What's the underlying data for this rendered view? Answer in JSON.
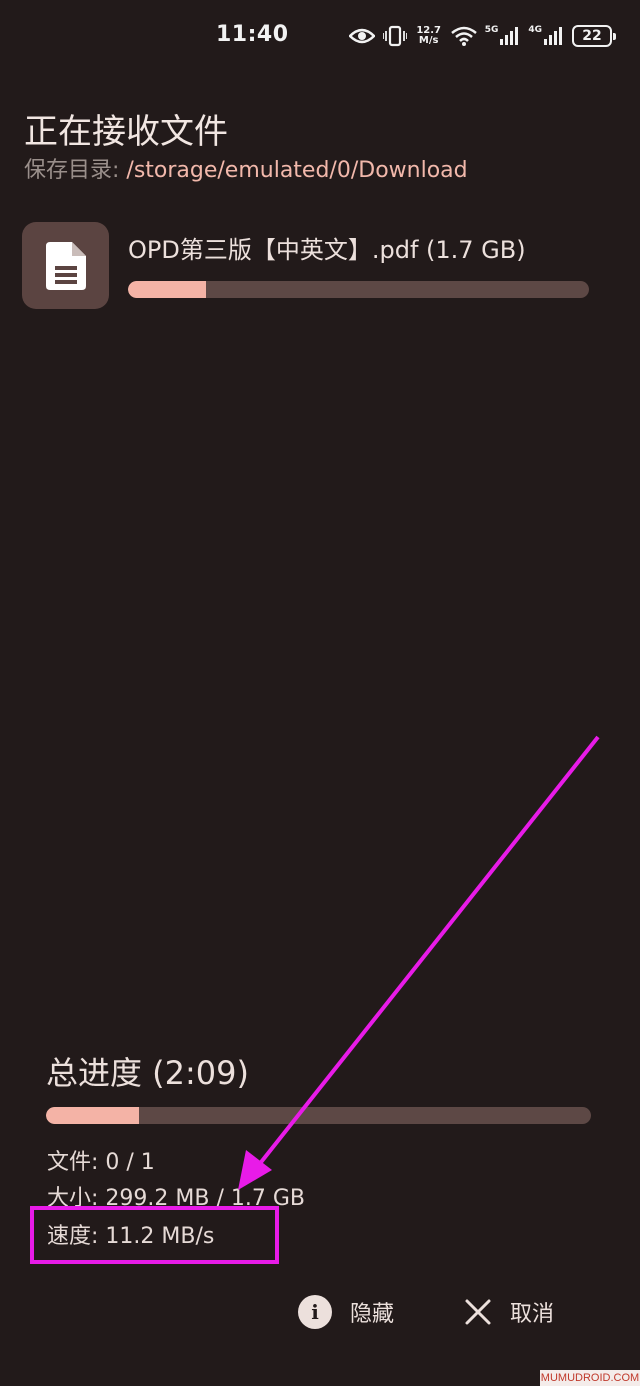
{
  "status_bar": {
    "time": "11:40",
    "net_speed_value": "12.7",
    "net_speed_unit": "M/s",
    "sig1_label": "5G",
    "sig2_label": "4G",
    "battery": "22"
  },
  "header": {
    "title": "正在接收文件",
    "save_dir_label": "保存目录: ",
    "save_dir_path": "/storage/emulated/0/Download"
  },
  "file": {
    "name": "OPD第三版【中英文】.pdf (1.7 GB)",
    "progress": 0.17,
    "icon": "document-icon"
  },
  "overall": {
    "title": "总进度 (2:09)",
    "progress": 0.17,
    "files": "文件:  0 / 1",
    "size": "大小:  299.2 MB / 1.7 GB",
    "speed": "速度:  11.2 MB/s"
  },
  "actions": {
    "hide_label": "隐藏",
    "cancel_label": "取消"
  },
  "colors": {
    "background": "#221a1a",
    "accent": "#f4b3a6",
    "track": "#5d4845",
    "annotation": "#e81be8"
  },
  "watermark": "MUMUDROID.COM"
}
